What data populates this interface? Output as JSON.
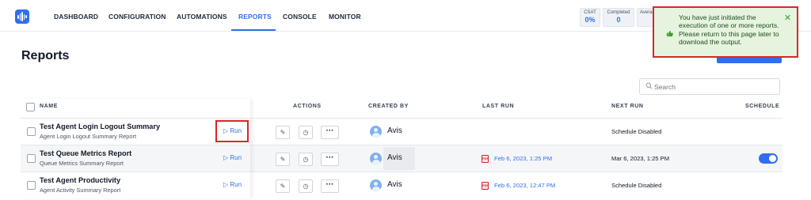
{
  "nav": {
    "items": [
      "DASHBOARD",
      "CONFIGURATION",
      "AUTOMATIONS",
      "REPORTS",
      "CONSOLE",
      "MONITOR"
    ],
    "active": "REPORTS",
    "stats": [
      {
        "label": "CSAT",
        "value": "0%"
      },
      {
        "label": "Completed",
        "value": "0"
      },
      {
        "label": "Averag",
        "value": ""
      }
    ]
  },
  "toast": {
    "message": "You have just initiated the execution of one or more reports. Please return to this page later to download the output.",
    "thumb_icon": "thumbs-up-icon",
    "close_icon": "close-icon"
  },
  "page": {
    "title": "Reports",
    "search_placeholder": "Search"
  },
  "table": {
    "headers": {
      "name": "NAME",
      "actions": "ACTIONS",
      "created_by": "CREATED BY",
      "last_run": "LAST RUN",
      "next_run": "NEXT RUN",
      "schedule": "SCHEDULE"
    },
    "run_label": "Run",
    "rows": [
      {
        "name": "Test Agent Login Logout Summary",
        "subtitle": "Agent Login Logout Summary Report",
        "created_by": "Avis",
        "last_run": "",
        "next_run": "Schedule Disabled",
        "schedule_on": false
      },
      {
        "name": "Test Queue Metrics Report",
        "subtitle": "Queue Metrics Summary Report",
        "created_by": "Avis",
        "last_run": "Feb 6, 2023, 1:25 PM",
        "next_run": "Mar 6, 2023, 1:25 PM",
        "schedule_on": true
      },
      {
        "name": "Test Agent Productivity",
        "subtitle": "Agent Activity Summary Report",
        "created_by": "Avis",
        "last_run": "Feb 6, 2023, 12:47 PM",
        "next_run": "Schedule Disabled",
        "schedule_on": false
      }
    ]
  },
  "colors": {
    "accent": "#2f6fed",
    "highlight": "#d9262c",
    "toast_bg": "#e6f4df"
  }
}
